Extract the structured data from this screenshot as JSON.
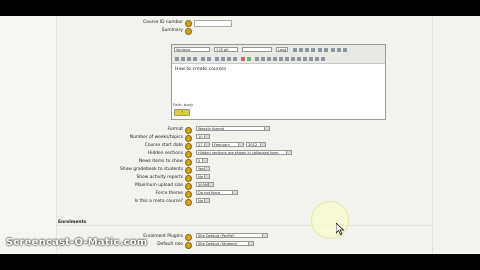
{
  "form": {
    "course_id_label": "Course ID number",
    "summary_label": "Summary",
    "editor": {
      "font_family": "Verdana",
      "font_size": "1 (8 pt)",
      "lang": "Lang",
      "content": "How to create courses",
      "path": "Path: body"
    },
    "format": {
      "label": "Format",
      "value": "Weekly format"
    },
    "sections": {
      "label": "Number of weeks/topics",
      "value": "10"
    },
    "start_date": {
      "label": "Course start date",
      "day": "27",
      "month": "February",
      "year": "2012"
    },
    "hidden_sections": {
      "label": "Hidden sections",
      "value": "Hidden sections are shown in collapsed form"
    },
    "news_items": {
      "label": "News items to show",
      "value": "5"
    },
    "gradebook": {
      "label": "Show gradebook to students",
      "value": "Yes"
    },
    "activity_reports": {
      "label": "Show activity reports",
      "value": "No"
    },
    "max_upload": {
      "label": "Maximum upload size",
      "value": "500MB"
    },
    "force_theme": {
      "label": "Force theme",
      "value": "Do not force"
    },
    "meta_course": {
      "label": "Is this a meta course?",
      "value": "No"
    },
    "enrolments_heading": "Enrolments",
    "enrol_plugins": {
      "label": "Enrolment Plugins",
      "value": "Site Default (PayPal)"
    },
    "default_role": {
      "label": "Default role",
      "value": "Site Default (Student)"
    }
  },
  "watermark": "Screencast-O-Matic.com",
  "colors": {
    "help_icon": "#d4a51a",
    "page_bg": "#f2f3ec"
  }
}
